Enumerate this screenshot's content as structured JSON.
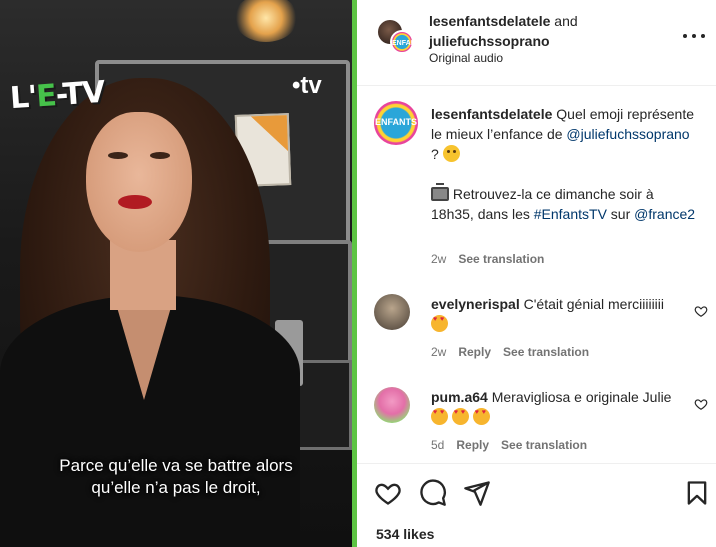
{
  "video": {
    "channel_logo": "L'E-TV",
    "channel_logo_main": "L'",
    "channel_logo_e": "E",
    "channel_logo_rest": "-TV",
    "network_logo": "•tv",
    "subtitle_line1": "Parce qu’elle va se battre alors",
    "subtitle_line2": "qu’elle n’a pas le droit,"
  },
  "header": {
    "user1": "lesenfantsdelatele",
    "and": " and",
    "user2": "juliefuchssoprano",
    "audio": "Original audio",
    "avatar_brand_text": "ENFANTS"
  },
  "caption": {
    "username": "lesenfantsdelatele",
    "text1": " Quel emoji représente le mieux l’enfance de ",
    "mention1": "@juliefuchssoprano",
    "text2": " ? ",
    "emoji1": "thinking-face",
    "text3": " Retrouvez-la ce dimanche soir à 18h35, dans les ",
    "hashtag": "#EnfantsTV",
    "text4": " sur ",
    "mention2": "@france2",
    "time": "2w",
    "see_translation": "See translation"
  },
  "comments": [
    {
      "username": "evelynerispal",
      "text": " C'était génial merciiiiiiii ",
      "emoji": "heart-eyes",
      "time": "2w",
      "reply": "Reply",
      "see_translation": "See translation"
    },
    {
      "username": "pum.a64",
      "text": " Meravigliosa e originale Julie ",
      "emoji": "heart-eyes x3",
      "time": "5d",
      "reply": "Reply",
      "see_translation": "See translation"
    }
  ],
  "actions": {
    "likes": "534 likes",
    "icons": [
      "heart-icon",
      "comment-icon",
      "share-icon",
      "bookmark-icon"
    ]
  },
  "colors": {
    "accent_green": "#5dc443",
    "link": "#00376b",
    "secondary_text": "#737373"
  }
}
